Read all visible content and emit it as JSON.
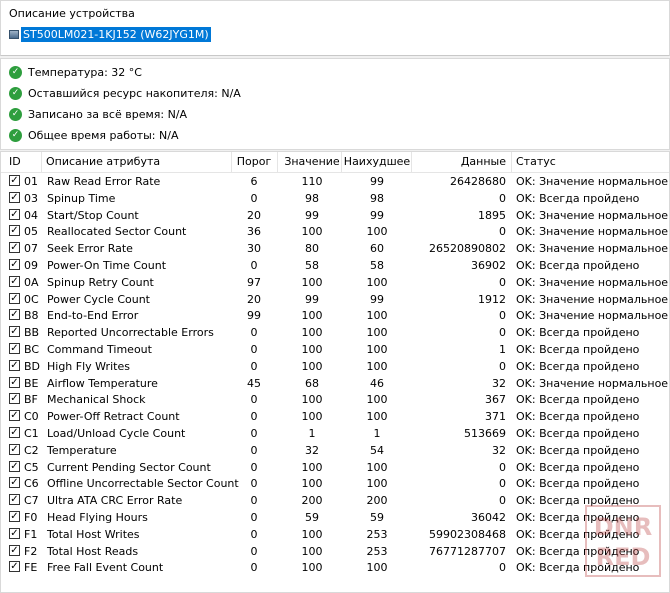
{
  "device": {
    "label": "Описание устройства",
    "name": "ST500LM021-1KJ152 (W62JYG1M)"
  },
  "status_items": [
    {
      "text": "Температура: 32 °C"
    },
    {
      "text": "Оставшийся ресурс накопителя: N/A"
    },
    {
      "text": "Записано за всё время: N/A"
    },
    {
      "text": "Общее время работы: N/A"
    }
  ],
  "table": {
    "headers": {
      "id": "ID",
      "attr": "Описание атрибута",
      "threshold": "Порог",
      "value": "Значение",
      "worst": "Наихудшее",
      "raw": "Данные",
      "status": "Статус"
    },
    "rows": [
      {
        "id": "01",
        "name": "Raw Read Error Rate",
        "threshold": "6",
        "value": "110",
        "worst": "99",
        "raw": "26428680",
        "status": "OK: Значение нормальное"
      },
      {
        "id": "03",
        "name": "Spinup Time",
        "threshold": "0",
        "value": "98",
        "worst": "98",
        "raw": "0",
        "status": "OK: Всегда пройдено"
      },
      {
        "id": "04",
        "name": "Start/Stop Count",
        "threshold": "20",
        "value": "99",
        "worst": "99",
        "raw": "1895",
        "status": "OK: Значение нормальное"
      },
      {
        "id": "05",
        "name": "Reallocated Sector Count",
        "threshold": "36",
        "value": "100",
        "worst": "100",
        "raw": "0",
        "status": "OK: Значение нормальное"
      },
      {
        "id": "07",
        "name": "Seek Error Rate",
        "threshold": "30",
        "value": "80",
        "worst": "60",
        "raw": "26520890802",
        "status": "OK: Значение нормальное"
      },
      {
        "id": "09",
        "name": "Power-On Time Count",
        "threshold": "0",
        "value": "58",
        "worst": "58",
        "raw": "36902",
        "status": "OK: Всегда пройдено"
      },
      {
        "id": "0A",
        "name": "Spinup Retry Count",
        "threshold": "97",
        "value": "100",
        "worst": "100",
        "raw": "0",
        "status": "OK: Значение нормальное"
      },
      {
        "id": "0C",
        "name": "Power Cycle Count",
        "threshold": "20",
        "value": "99",
        "worst": "99",
        "raw": "1912",
        "status": "OK: Значение нормальное"
      },
      {
        "id": "B8",
        "name": "End-to-End Error",
        "threshold": "99",
        "value": "100",
        "worst": "100",
        "raw": "0",
        "status": "OK: Значение нормальное"
      },
      {
        "id": "BB",
        "name": "Reported Uncorrectable Errors",
        "threshold": "0",
        "value": "100",
        "worst": "100",
        "raw": "0",
        "status": "OK: Всегда пройдено"
      },
      {
        "id": "BC",
        "name": "Command Timeout",
        "threshold": "0",
        "value": "100",
        "worst": "100",
        "raw": "1",
        "status": "OK: Всегда пройдено"
      },
      {
        "id": "BD",
        "name": "High Fly Writes",
        "threshold": "0",
        "value": "100",
        "worst": "100",
        "raw": "0",
        "status": "OK: Всегда пройдено"
      },
      {
        "id": "BE",
        "name": "Airflow Temperature",
        "threshold": "45",
        "value": "68",
        "worst": "46",
        "raw": "32",
        "status": "OK: Значение нормальное"
      },
      {
        "id": "BF",
        "name": "Mechanical Shock",
        "threshold": "0",
        "value": "100",
        "worst": "100",
        "raw": "367",
        "status": "OK: Всегда пройдено"
      },
      {
        "id": "C0",
        "name": "Power-Off Retract Count",
        "threshold": "0",
        "value": "100",
        "worst": "100",
        "raw": "371",
        "status": "OK: Всегда пройдено"
      },
      {
        "id": "C1",
        "name": "Load/Unload Cycle Count",
        "threshold": "0",
        "value": "1",
        "worst": "1",
        "raw": "513669",
        "status": "OK: Всегда пройдено"
      },
      {
        "id": "C2",
        "name": "Temperature",
        "threshold": "0",
        "value": "32",
        "worst": "54",
        "raw": "32",
        "status": "OK: Всегда пройдено"
      },
      {
        "id": "C5",
        "name": "Current Pending Sector Count",
        "threshold": "0",
        "value": "100",
        "worst": "100",
        "raw": "0",
        "status": "OK: Всегда пройдено"
      },
      {
        "id": "C6",
        "name": "Offline Uncorrectable Sector Count",
        "threshold": "0",
        "value": "100",
        "worst": "100",
        "raw": "0",
        "status": "OK: Всегда пройдено"
      },
      {
        "id": "C7",
        "name": "Ultra ATA CRC Error Rate",
        "threshold": "0",
        "value": "200",
        "worst": "200",
        "raw": "0",
        "status": "OK: Всегда пройдено"
      },
      {
        "id": "F0",
        "name": "Head Flying Hours",
        "threshold": "0",
        "value": "59",
        "worst": "59",
        "raw": "36042",
        "status": "OK: Всегда пройдено"
      },
      {
        "id": "F1",
        "name": "Total Host Writes",
        "threshold": "0",
        "value": "100",
        "worst": "253",
        "raw": "59902308468",
        "status": "OK: Всегда пройдено"
      },
      {
        "id": "F2",
        "name": "Total Host Reads",
        "threshold": "0",
        "value": "100",
        "worst": "253",
        "raw": "76771287707",
        "status": "OK: Всегда пройдено"
      },
      {
        "id": "FE",
        "name": "Free Fall Event Count",
        "threshold": "0",
        "value": "100",
        "worst": "100",
        "raw": "0",
        "status": "OK: Всегда пройдено"
      }
    ]
  },
  "watermark": {
    "line1": "DNR",
    "line2": "RED"
  },
  "colors": {
    "selection": "#0078d7",
    "ok_green": "#2e9e3e"
  }
}
